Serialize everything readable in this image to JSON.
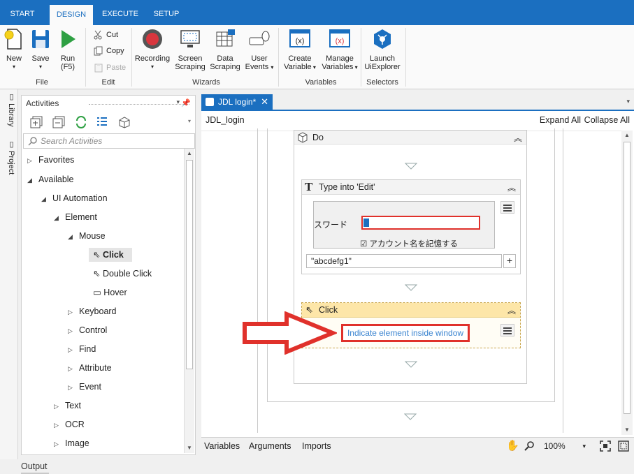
{
  "menu": {
    "tabs": [
      "START",
      "DESIGN",
      "EXECUTE",
      "SETUP"
    ],
    "active": "DESIGN"
  },
  "ribbon": {
    "file": {
      "new": "New",
      "save": "Save",
      "run": "Run",
      "run_key": "(F5)",
      "group": "File"
    },
    "edit": {
      "cut": "Cut",
      "copy": "Copy",
      "paste": "Paste",
      "group": "Edit"
    },
    "wizards": {
      "recording": "Recording",
      "screen_scraping_1": "Screen",
      "screen_scraping_2": "Scraping",
      "data_scraping_1": "Data",
      "data_scraping_2": "Scraping",
      "user_events_1": "User",
      "user_events_2": "Events",
      "group": "Wizards"
    },
    "variables": {
      "create_1": "Create",
      "create_2": "Variable",
      "manage_1": "Manage",
      "manage_2": "Variables",
      "group": "Variables"
    },
    "selectors": {
      "launch_1": "Launch",
      "launch_2": "UiExplorer",
      "group": "Selectors"
    },
    "colors": {
      "accent": "#1b6fc0",
      "run_green": "#2ea043",
      "record_red": "#d9363e"
    }
  },
  "sidebar": {
    "library": "Library",
    "project": "Project"
  },
  "activities": {
    "title": "Activities",
    "search_placeholder": "Search Activities",
    "tree": {
      "favorites": "Favorites",
      "available": "Available",
      "ui_automation": "UI Automation",
      "element": "Element",
      "mouse": "Mouse",
      "click": "Click",
      "double_click": "Double Click",
      "hover": "Hover",
      "keyboard": "Keyboard",
      "control": "Control",
      "find": "Find",
      "attribute": "Attribute",
      "event": "Event",
      "text": "Text",
      "ocr": "OCR",
      "image": "Image"
    }
  },
  "designer": {
    "tab_title": "JDL login*",
    "breadcrumb": "JDL_login",
    "expand_all": "Expand All",
    "collapse_all": "Collapse All",
    "do_label": "Do",
    "type_into": {
      "title": "Type into 'Edit'",
      "screenshot_label": "スワード",
      "screenshot_checkbox": "アカウント名を記憶する",
      "text_value": "\"abcdefg1\""
    },
    "click": {
      "title": "Click",
      "indicate_link": "Indicate element inside window"
    }
  },
  "bottom": {
    "variables": "Variables",
    "arguments": "Arguments",
    "imports": "Imports",
    "zoom": "100%"
  },
  "output": {
    "label": "Output"
  }
}
